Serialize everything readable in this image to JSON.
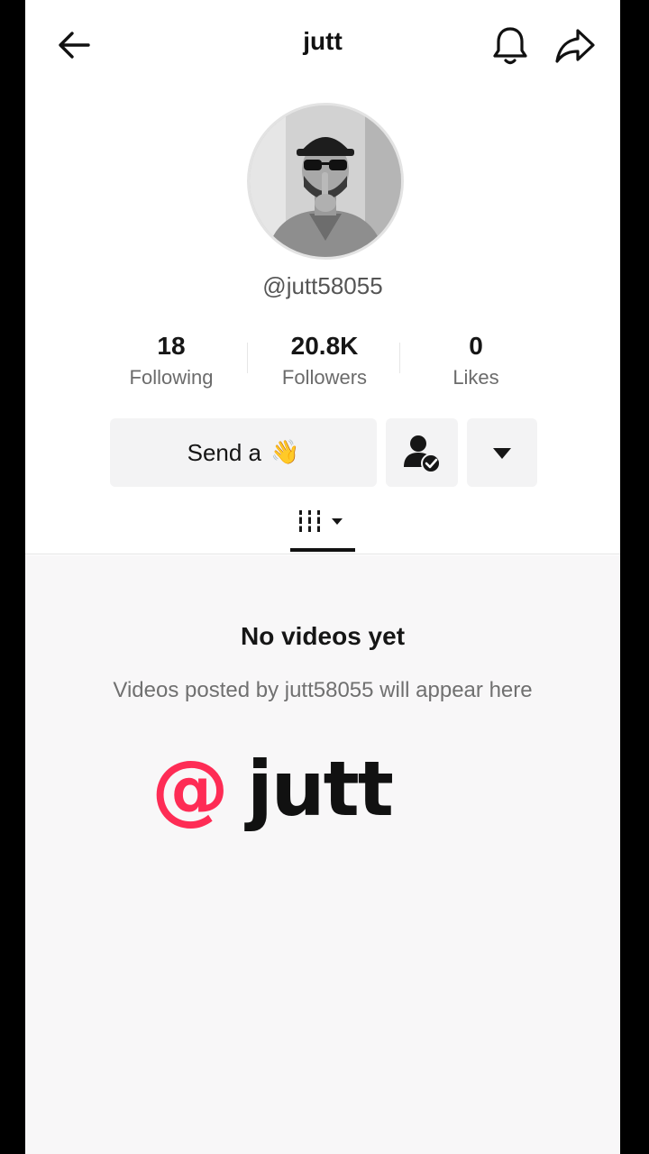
{
  "header": {
    "title": "jutt"
  },
  "profile": {
    "username": "@jutt58055",
    "avatar_alt": "profile photo"
  },
  "stats": [
    {
      "value": "18",
      "label": "Following"
    },
    {
      "value": "20.8K",
      "label": "Followers"
    },
    {
      "value": "0",
      "label": "Likes"
    }
  ],
  "actions": {
    "send_label": "Send a",
    "send_emoji": "👋"
  },
  "empty_state": {
    "title": "No videos yet",
    "subtitle": "Videos posted by jutt58055 will appear here"
  },
  "watermark": {
    "at": "@",
    "text": "jutt"
  },
  "colors": {
    "accent": "#fe2c55",
    "text": "#161616",
    "button_bg": "#f3f3f4"
  },
  "icons": [
    "back-arrow-icon",
    "bell-icon",
    "share-icon",
    "friends-check-icon",
    "chevron-down-icon",
    "grid-icon"
  ]
}
